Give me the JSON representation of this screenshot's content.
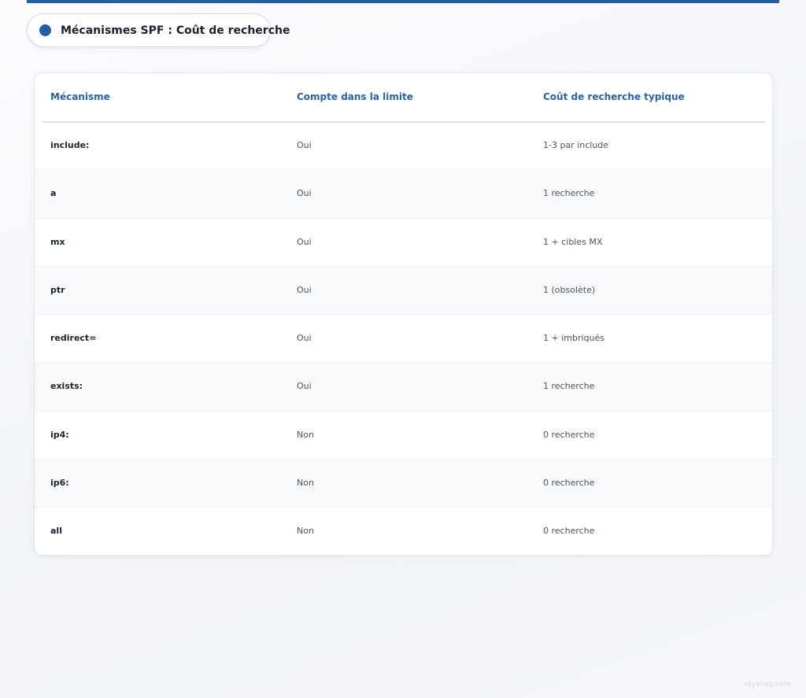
{
  "header": {
    "title": "Mécanismes SPF : Coût de recherche",
    "accent_color": "#1f5fa8"
  },
  "table": {
    "columns": [
      "Mécanisme",
      "Compte dans la limite",
      "Coût de recherche typique"
    ],
    "rows": [
      [
        "include:",
        "Oui",
        "1-3 par include"
      ],
      [
        "a",
        "Oui",
        "1 recherche"
      ],
      [
        "mx",
        "Oui",
        "1 + cibles MX"
      ],
      [
        "ptr",
        "Oui",
        "1 (obsolète)"
      ],
      [
        "redirect=",
        "Oui",
        "1 + imbriqués"
      ],
      [
        "exists:",
        "Oui",
        "1 recherche"
      ],
      [
        "ip4:",
        "Non",
        "0 recherche"
      ],
      [
        "ip6:",
        "Non",
        "0 recherche"
      ],
      [
        "all",
        "Non",
        "0 recherche"
      ]
    ]
  },
  "watermark": "skysnag.com"
}
